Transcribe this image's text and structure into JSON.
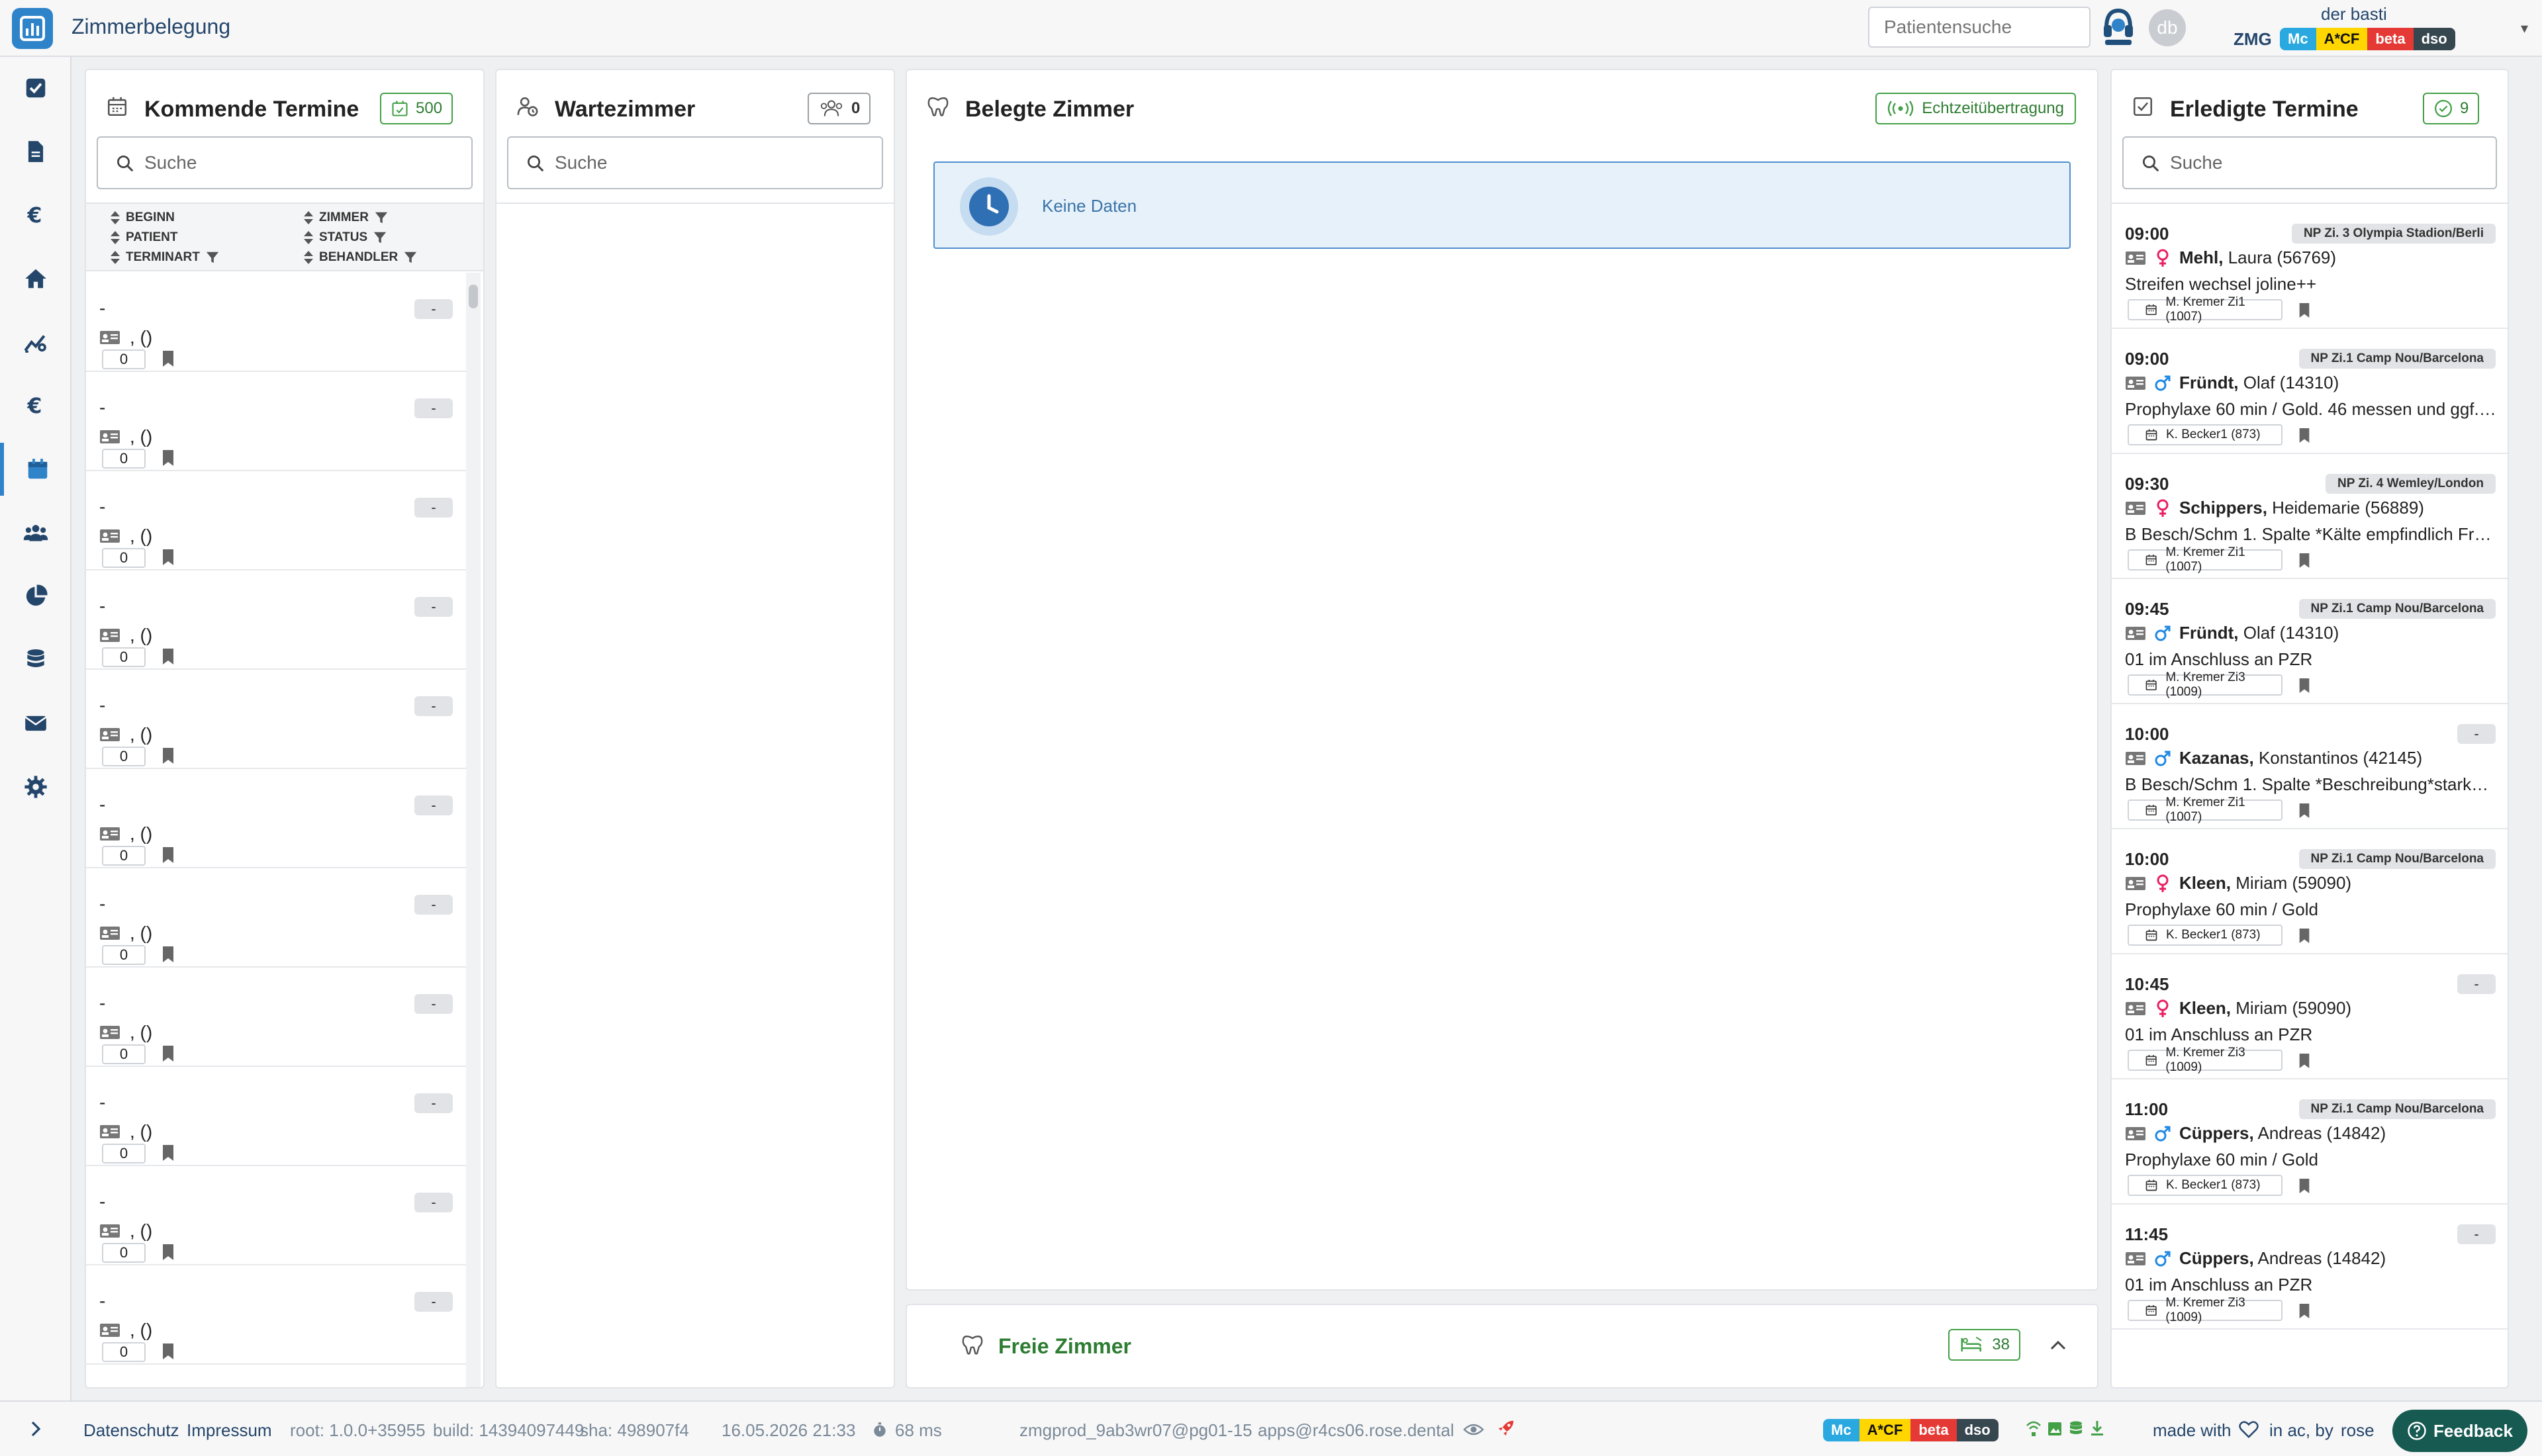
{
  "app": {
    "title": "Zimmerbelegung",
    "logo_color": "#2f83c8"
  },
  "header": {
    "search_placeholder": "Patientensuche",
    "avatar_initials": "db",
    "user_name": "der basti",
    "org": "ZMG",
    "badges": [
      {
        "label": "Mc",
        "bg": "#29a9e0",
        "fg": "#ffffff"
      },
      {
        "label": "A*CF",
        "bg": "#ffd600",
        "fg": "#111111"
      },
      {
        "label": "beta",
        "bg": "#e53935",
        "fg": "#ffffff"
      },
      {
        "label": "dso",
        "bg": "#37474f",
        "fg": "#ffffff"
      }
    ]
  },
  "sidebar": {
    "items": [
      {
        "icon": "checkbox-icon"
      },
      {
        "icon": "document-icon"
      },
      {
        "icon": "euro-icon"
      },
      {
        "icon": "home-icon"
      },
      {
        "icon": "chart-settings-icon"
      },
      {
        "icon": "euro-icon"
      },
      {
        "icon": "calendar-icon",
        "active": true
      },
      {
        "icon": "users-icon"
      },
      {
        "icon": "pie-chart-icon"
      },
      {
        "icon": "database-icon"
      },
      {
        "icon": "mail-icon"
      },
      {
        "icon": "gear-icon"
      }
    ]
  },
  "upcoming": {
    "title": "Kommende Termine",
    "count": "500",
    "search_placeholder": "Suche",
    "columns": {
      "beginn": "BEGINN",
      "patient": "PATIENT",
      "terminart": "TERMINART",
      "zimmer": "ZIMMER",
      "status": "STATUS",
      "behandler": "BEHANDLER"
    },
    "items": [
      {
        "time": "-",
        "chip": "-",
        "name": ", ()",
        "num": "0"
      },
      {
        "time": "-",
        "chip": "-",
        "name": ", ()",
        "num": "0"
      },
      {
        "time": "-",
        "chip": "-",
        "name": ", ()",
        "num": "0"
      },
      {
        "time": "-",
        "chip": "-",
        "name": ", ()",
        "num": "0"
      },
      {
        "time": "-",
        "chip": "-",
        "name": ", ()",
        "num": "0"
      },
      {
        "time": "-",
        "chip": "-",
        "name": ", ()",
        "num": "0"
      },
      {
        "time": "-",
        "chip": "-",
        "name": ", ()",
        "num": "0"
      },
      {
        "time": "-",
        "chip": "-",
        "name": ", ()",
        "num": "0"
      },
      {
        "time": "-",
        "chip": "-",
        "name": ", ()",
        "num": "0"
      },
      {
        "time": "-",
        "chip": "-",
        "name": ", ()",
        "num": "0"
      },
      {
        "time": "-",
        "chip": "-",
        "name": ", ()",
        "num": "0"
      }
    ]
  },
  "waiting": {
    "title": "Wartezimmer",
    "count": "0",
    "search_placeholder": "Suche"
  },
  "occupied": {
    "title": "Belegte Zimmer",
    "live_label": "Echtzeitübertragung",
    "empty_text": "Keine Daten"
  },
  "free": {
    "title": "Freie Zimmer",
    "count": "38"
  },
  "done": {
    "title": "Erledigte Termine",
    "count": "9",
    "search_placeholder": "Suche",
    "items": [
      {
        "time": "09:00",
        "room": "NP Zi. 3 Olympia Stadion/Berli",
        "gender": "female",
        "last": "Mehl,",
        "first": "Laura (56769)",
        "note": "Streifen wechsel joline++",
        "staff": "M. Kremer Zi1 (1007)"
      },
      {
        "time": "09:00",
        "room": "NP Zi.1 Camp Nou/Barcelona",
        "gender": "male",
        "last": "Fründt,",
        "first": "Olaf (14310)",
        "note": "Prophylaxe 60 min / Gold. 46 messen und ggf. …",
        "staff": "K. Becker1 (873)"
      },
      {
        "time": "09:30",
        "room": "NP Zi. 4 Wemley/London",
        "gender": "female",
        "last": "Schippers,",
        "first": "Heidemarie (56889)",
        "note": "B Besch/Schm 1. Spalte *Kälte empfindlich Fro…",
        "staff": "M. Kremer Zi1 (1007)"
      },
      {
        "time": "09:45",
        "room": "NP Zi.1 Camp Nou/Barcelona",
        "gender": "male",
        "last": "Fründt,",
        "first": "Olaf (14310)",
        "note": "01 im Anschluss an PZR",
        "staff": "M. Kremer Zi3 (1009)"
      },
      {
        "time": "10:00",
        "room": "-",
        "gender": "male",
        "last": "Kazanas,",
        "first": "Konstantinos (42145)",
        "note": "B Besch/Schm 1. Spalte *Beschreibung*starke…",
        "staff": "M. Kremer Zi1 (1007)"
      },
      {
        "time": "10:00",
        "room": "NP Zi.1 Camp Nou/Barcelona",
        "gender": "female",
        "last": "Kleen,",
        "first": "Miriam (59090)",
        "note": "Prophylaxe 60 min / Gold",
        "staff": "K. Becker1 (873)"
      },
      {
        "time": "10:45",
        "room": "-",
        "gender": "female",
        "last": "Kleen,",
        "first": "Miriam (59090)",
        "note": "01 im Anschluss an PZR",
        "staff": "M. Kremer Zi3 (1009)"
      },
      {
        "time": "11:00",
        "room": "NP Zi.1 Camp Nou/Barcelona",
        "gender": "male",
        "last": "Cüppers,",
        "first": "Andreas (14842)",
        "note": "Prophylaxe 60 min / Gold",
        "staff": "K. Becker1 (873)"
      },
      {
        "time": "11:45",
        "room": "-",
        "gender": "male",
        "last": "Cüppers,",
        "first": "Andreas (14842)",
        "note": "01 im Anschluss an PZR",
        "staff": "M. Kremer Zi3 (1009)"
      }
    ]
  },
  "footer": {
    "datenschutz": "Datenschutz",
    "impressum": "Impressum",
    "root": "root: 1.0.0+35955",
    "build": "build: 14394097449",
    "sha": "sha: 498907f4",
    "datetime": "16.05.2026 21:33",
    "latency": "68 ms",
    "host": "zmgprod_9ab3wr07@pg01-15",
    "apps": "apps@r4cs06.rose.dental",
    "made_with": "made with",
    "in_ac": "in ac, by",
    "by_name": "rose",
    "feedback": "Feedback"
  },
  "colors": {
    "green": "#43a047",
    "blue": "#2f83c8",
    "female": "#e91e63",
    "male": "#1e88e5",
    "feedback": "#175a52"
  }
}
